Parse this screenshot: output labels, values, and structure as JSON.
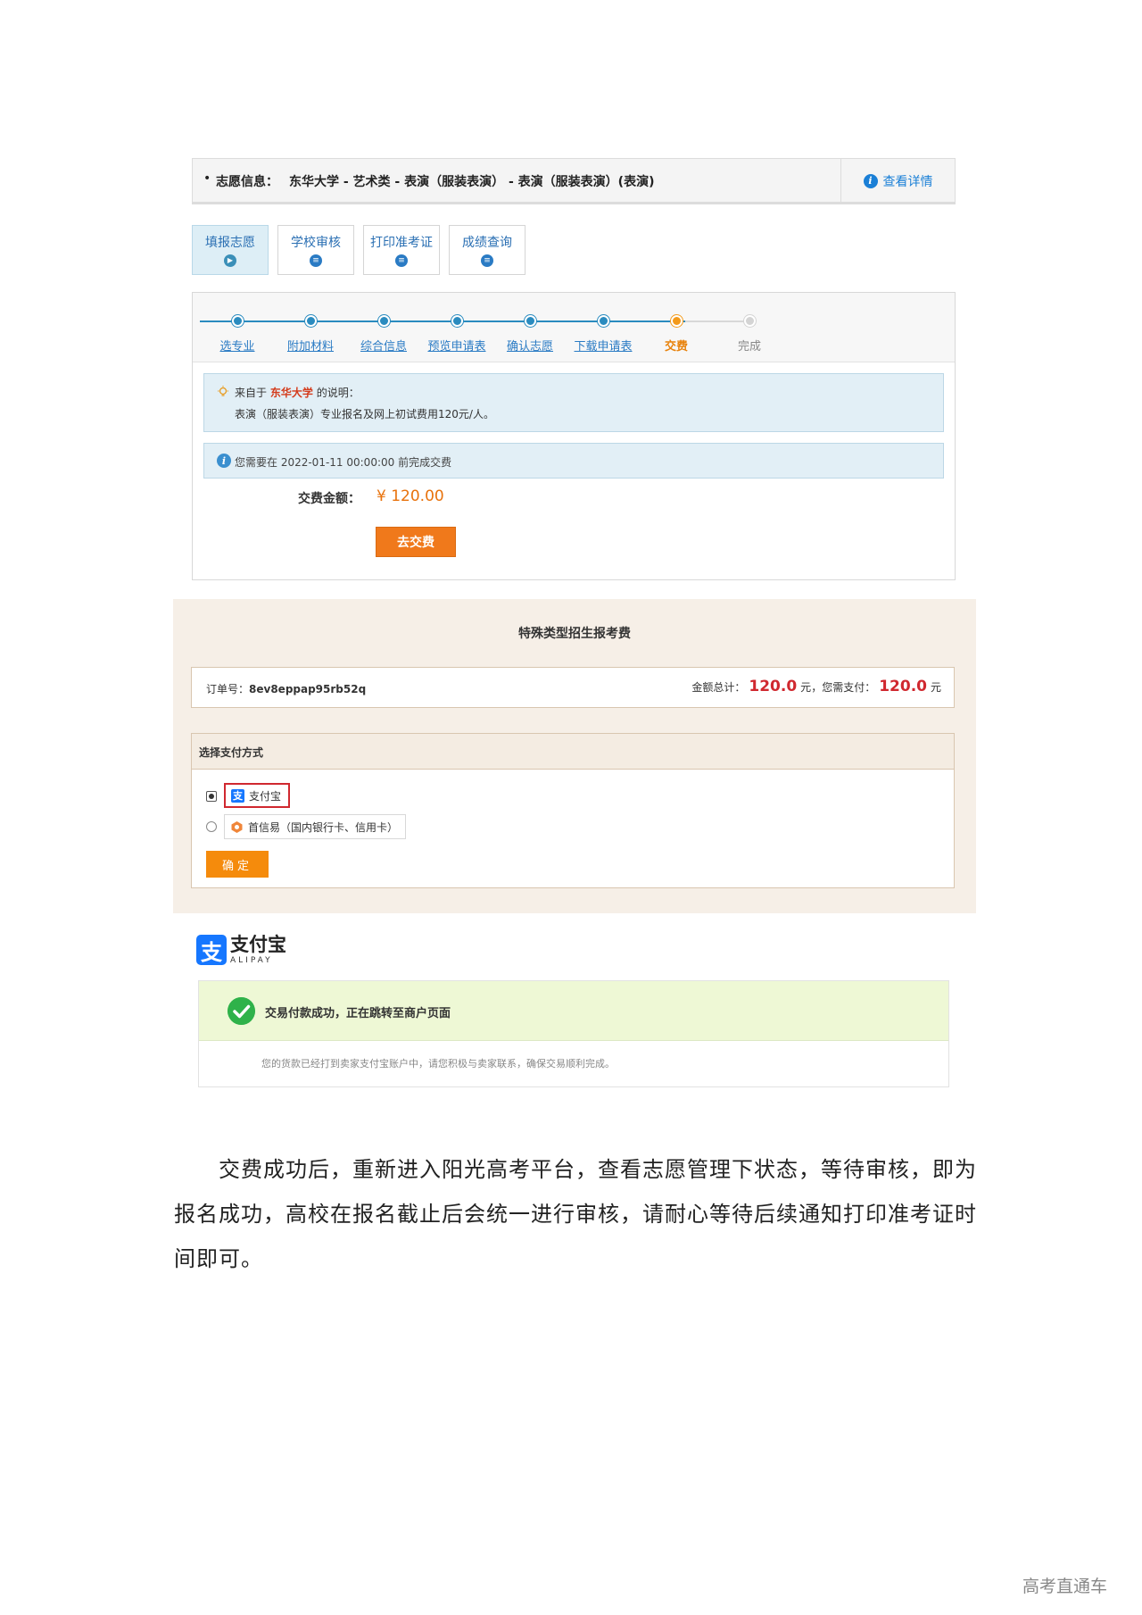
{
  "application": {
    "bullet": "•",
    "info_label": "志愿信息：",
    "info_value": "东华大学 - 艺术类 - 表演（服装表演） - 表演（服装表演）(表演)",
    "detail_icon": "i",
    "detail_link": "查看详情",
    "tabs": [
      {
        "label": "填报志愿",
        "icon": "▶"
      },
      {
        "label": "学校审核",
        "icon": "≡"
      },
      {
        "label": "打印准考证",
        "icon": "≡"
      },
      {
        "label": "成绩查询",
        "icon": "≡"
      }
    ],
    "steps": [
      {
        "label": "选专业",
        "state": "done"
      },
      {
        "label": "附加材料",
        "state": "done"
      },
      {
        "label": "综合信息",
        "state": "done"
      },
      {
        "label": "预览申请表",
        "state": "done"
      },
      {
        "label": "确认志愿",
        "state": "done"
      },
      {
        "label": "下载申请表",
        "state": "done"
      },
      {
        "label": "交费",
        "state": "current"
      },
      {
        "label": "完成",
        "state": "todo"
      }
    ],
    "note_prefix": "来自于",
    "note_school": "东华大学",
    "note_suffix": "的说明：",
    "note_text": "表演（服装表演）专业报名及网上初试费用120元/人。",
    "deadline_text": "您需要在 2022-01-11 00:00:00 前完成交费",
    "fee_label": "交费金额：",
    "fee_amount": "¥ 120.00",
    "pay_button": "去交费"
  },
  "payment": {
    "title": "特殊类型招生报考费",
    "order_label": "订单号：",
    "order_no": "8ev8eppap95rb52q",
    "total_label": "金额总计：",
    "total_value": "120.0",
    "unit": "元",
    "need_label": "，您需支付：",
    "need_value": "120.0",
    "unit2": "元",
    "method_title": "选择支付方式",
    "methods": [
      {
        "label": "支付宝",
        "selected": true
      },
      {
        "label": "首信易（国内银行卡、信用卡）",
        "selected": false
      }
    ],
    "confirm_button": "确定"
  },
  "alipay": {
    "logo_mark": "支",
    "logo_cn": "支付宝",
    "logo_en": "ALIPAY",
    "success_text": "交易付款成功，正在跳转至商户页面",
    "success_sub": "您的货款已经打到卖家支付宝账户中，请您积极与卖家联系，确保交易顺利完成。"
  },
  "paragraph": "交费成功后，重新进入阳光高考平台，查看志愿管理下状态，等待审核，即为报名成功，高校在报名截止后会统一进行审核，请耐心等待后续通知打印准考证时间即可。",
  "footer": "高考直通车",
  "colors": {
    "accent_blue": "#2a8bbf",
    "current_orange": "#f39a1a",
    "pay_orange": "#f0791b",
    "price_red": "#d0282f",
    "success_green": "#2fb24a",
    "alipay_blue": "#1677ff"
  }
}
